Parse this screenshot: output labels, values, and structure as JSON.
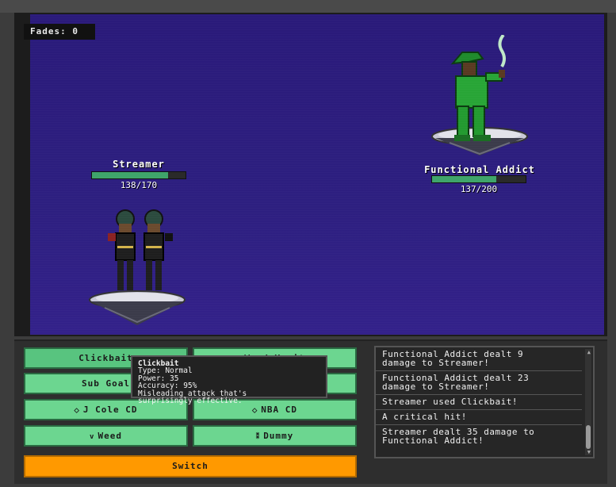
{
  "hud": {
    "fades_label": "Fades: 0"
  },
  "player": {
    "name": "Streamer",
    "hp_text": "138/170",
    "hp_fraction": 0.81
  },
  "enemy": {
    "name": "Functional Addict",
    "hp_text": "137/200",
    "hp_fraction": 0.685
  },
  "moves": [
    {
      "label": "Clickbait",
      "icon": ""
    },
    {
      "label": "Word Vomit",
      "icon": ""
    },
    {
      "label": "Sub Goal",
      "icon": ""
    },
    {
      "label": "",
      "icon": ""
    },
    {
      "label": "J Cole CD",
      "icon": "cd-icon"
    },
    {
      "label": "NBA CD",
      "icon": "cd-icon"
    },
    {
      "label": "Weed",
      "icon": "leaf-icon"
    },
    {
      "label": "Dummy",
      "icon": "dummy-icon"
    }
  ],
  "switch_label": "Switch",
  "tooltip": {
    "title": "Clickbait",
    "type": "Type: Normal",
    "power": "Power: 35",
    "accuracy": "Accuracy: 95%",
    "desc1": "Misleading attack that's",
    "desc2": "surprisingly effective."
  },
  "battle_log": [
    {
      "line1": "Functional Addict dealt 9",
      "line2": "damage to Streamer!"
    },
    {
      "line1": "Functional Addict dealt 23",
      "line2": "damage to Streamer!"
    },
    {
      "line1": "Streamer used Clickbait!",
      "line2": ""
    },
    {
      "line1": "A critical hit!",
      "line2": ""
    },
    {
      "line1": "Streamer dealt 35 damage to",
      "line2": "Functional Addict!"
    }
  ],
  "colors": {
    "stage": "#2d1f80",
    "hp": "#3fa56b",
    "move_button": "#6cd690",
    "switch": "#ff9900"
  }
}
